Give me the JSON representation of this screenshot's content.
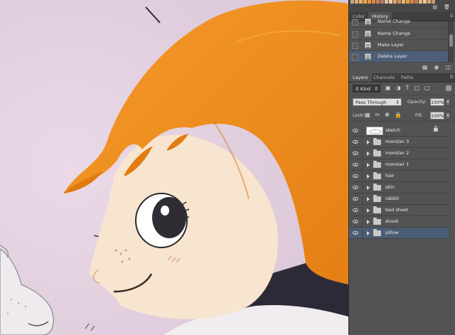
{
  "history_panel": {
    "tabs": [
      {
        "label": "Color",
        "active": false
      },
      {
        "label": "History",
        "active": true
      }
    ],
    "items": [
      {
        "label": "Name Change",
        "selected": false
      },
      {
        "label": "Name Change",
        "selected": false
      },
      {
        "label": "Make Layer",
        "selected": false
      },
      {
        "label": "Delete Layer",
        "selected": true
      }
    ],
    "footer_icons": [
      "new-document-from-state-icon",
      "snapshot-camera-icon",
      "trash-icon"
    ]
  },
  "layers_panel": {
    "tabs": [
      {
        "label": "Layers",
        "active": true
      },
      {
        "label": "Channels",
        "active": false
      },
      {
        "label": "Paths",
        "active": false
      }
    ],
    "filter": {
      "kind_label": "Kind",
      "icons": [
        "pixel-filter-icon",
        "adjustment-filter-icon",
        "type-filter-icon",
        "shape-filter-icon",
        "smart-object-filter-icon"
      ]
    },
    "blend_mode": "Pass Through",
    "opacity_label": "Opacity:",
    "opacity_value": "100%",
    "lock_label": "Lock:",
    "lock_icons": [
      "lock-transparent-icon",
      "lock-paint-icon",
      "lock-move-icon",
      "lock-all-icon"
    ],
    "fill_label": "Fill:",
    "fill_value": "100%",
    "layers": [
      {
        "name": "sketch",
        "type": "pixel",
        "visible": true,
        "locked": true,
        "selected": false
      },
      {
        "name": "monster 3",
        "type": "group",
        "visible": true,
        "locked": false,
        "selected": false
      },
      {
        "name": "monster 2",
        "type": "group",
        "visible": true,
        "locked": false,
        "selected": false
      },
      {
        "name": "monster 1",
        "type": "group",
        "visible": true,
        "locked": false,
        "selected": false
      },
      {
        "name": "hair",
        "type": "group",
        "visible": true,
        "locked": false,
        "selected": false
      },
      {
        "name": "skin",
        "type": "group",
        "visible": true,
        "locked": false,
        "selected": false
      },
      {
        "name": "rabbit",
        "type": "group",
        "visible": true,
        "locked": false,
        "selected": false
      },
      {
        "name": "bed sheet",
        "type": "group",
        "visible": true,
        "locked": false,
        "selected": false
      },
      {
        "name": "duvet",
        "type": "group",
        "visible": true,
        "locked": false,
        "selected": false
      },
      {
        "name": "pillow",
        "type": "group",
        "visible": true,
        "locked": false,
        "selected": true
      }
    ]
  },
  "colors": {
    "canvas_background": "#e3d3e0",
    "hair": "#ee8a1e",
    "skin": "#f6e3cc",
    "panel": "#535353",
    "selected_row": "#4b5d74"
  }
}
